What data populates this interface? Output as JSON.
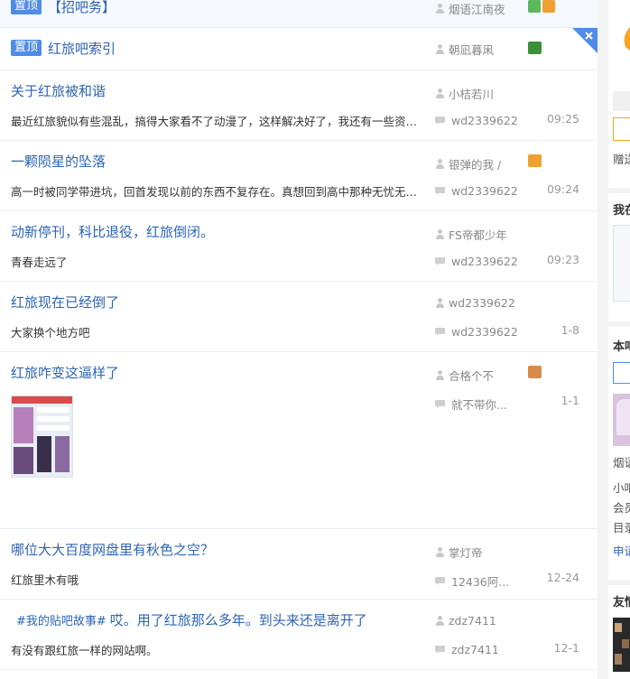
{
  "posts": [
    {
      "badge": "置顶",
      "title": "【招吧务】",
      "author": "烟语江南夜",
      "is_top": true
    },
    {
      "badge": "置顶",
      "title": "红旅吧索引",
      "author": "朝凪暮凩"
    },
    {
      "title": "关于红旅被和谐",
      "excerpt": "最近红旅貌似有些混乱，搞得大家看不了动漫了，这样解决好了，我还有一些资源，...",
      "author": "小桔若川",
      "last_reply": "wd2339622",
      "time": "09:25"
    },
    {
      "title": "一颗陨星的坠落",
      "excerpt": "高一时被同学带进坑，回首发现以前的东西不复存在。真想回到高中那种无忧无虑的...",
      "author": "银弹的我 /",
      "last_reply": "wd2339622",
      "time": "09:24"
    },
    {
      "title": "动新停刊，科比退役，红旅倒闭。",
      "excerpt": "青春走远了",
      "author": "FS帝都少年",
      "last_reply": "wd2339622",
      "time": "09:23"
    },
    {
      "title": "红旅现在已经倒了",
      "excerpt": "大家换个地方吧",
      "author": "wd2339622",
      "last_reply": "wd2339622",
      "time": "1-8"
    },
    {
      "title": "红旅咋变这逼样了",
      "excerpt": "",
      "author": "合格个不",
      "last_reply": "就不带你...",
      "time": "1-1"
    },
    {
      "title": "哪位大大百度网盘里有秋色之空？",
      "excerpt": "红旅里木有哦",
      "author": "掌灯帝",
      "last_reply": "12436阿...",
      "time": "12-24"
    },
    {
      "topic": "#我的贴吧故事#",
      "title": "哎。用了红旅那么多年。到头来还是离开了",
      "excerpt": "有没有跟红旅一样的网站啊。",
      "author": "zdz7411",
      "last_reply": "zdz7411",
      "time": "12-1"
    }
  ],
  "sidebar": {
    "frag1": "赠送",
    "frag2": "我在",
    "frag3": "本吧",
    "frag4": "烟语",
    "frag5": "小吧",
    "frag6": "会员",
    "frag7": "目录",
    "frag8": "申请",
    "frag9": "友情"
  },
  "colors": {
    "accent": "#2d64b3",
    "badge": "#4f8ce6",
    "orange": "#f5a623"
  },
  "icons": {
    "close": "close-icon",
    "user": "user-icon",
    "reply": "reply-icon"
  }
}
